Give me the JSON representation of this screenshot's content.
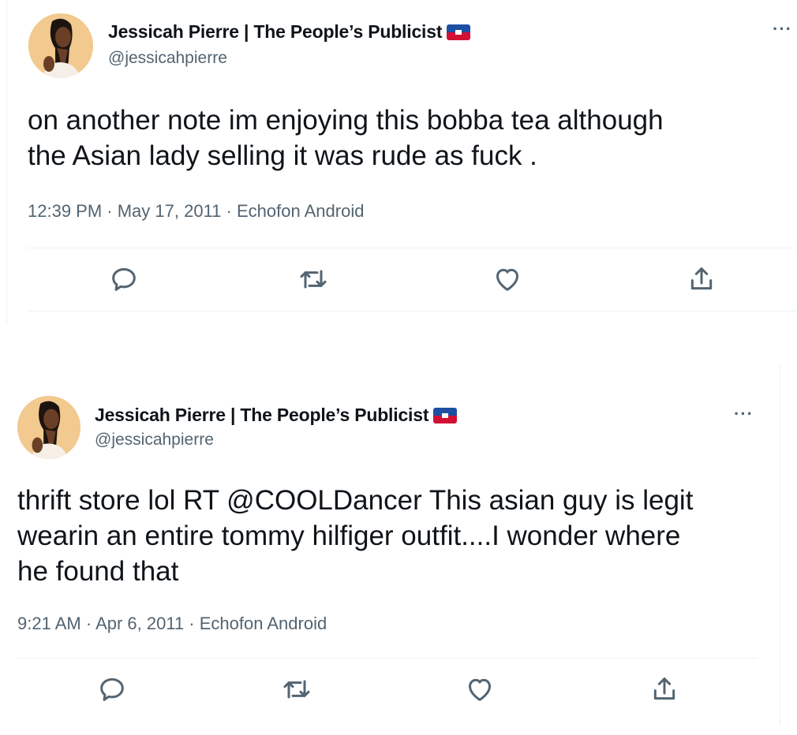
{
  "tweets": [
    {
      "author": {
        "display_name": "Jessicah Pierre | The People’s Publicist",
        "handle": "@jessicahpierre",
        "flag_icon": "haiti-flag-icon"
      },
      "more_label": "···",
      "text_lines": [
        "on another note im enjoying this bobba tea although",
        "the Asian lady selling it was rude as fuck ."
      ],
      "meta": {
        "time": "12:39 PM",
        "date": "May 17, 2011",
        "source": "Echofon Android",
        "separator": " · "
      },
      "actions": [
        "reply-icon",
        "retweet-icon",
        "like-icon",
        "share-icon"
      ]
    },
    {
      "author": {
        "display_name": "Jessicah Pierre | The People’s Publicist",
        "handle": "@jessicahpierre",
        "flag_icon": "haiti-flag-icon"
      },
      "more_label": "···",
      "text_lines": [
        "thrift store lol RT @COOLDancer This asian guy is legit",
        "wearin an entire tommy hilfiger outfit....I wonder where",
        "he found that"
      ],
      "meta": {
        "time": "9:21 AM",
        "date": "Apr 6, 2011",
        "source": "Echofon Android",
        "separator": " · "
      },
      "actions": [
        "reply-icon",
        "retweet-icon",
        "like-icon",
        "share-icon"
      ]
    }
  ],
  "colors": {
    "text": "#0f1419",
    "secondary": "#536471",
    "divider": "#eff3f4",
    "avatar_bg": "#f2c98e"
  }
}
